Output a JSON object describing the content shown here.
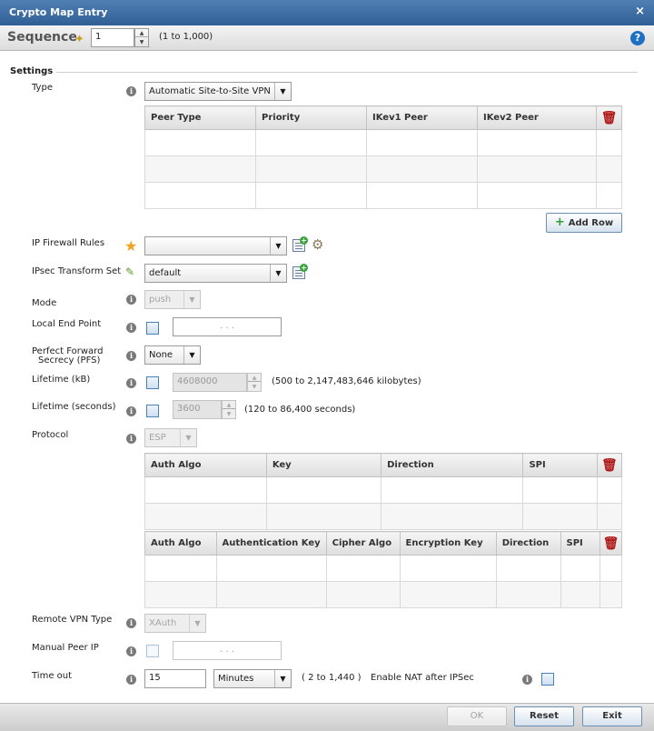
{
  "window": {
    "title": "Crypto Map Entry",
    "close_glyph": "×"
  },
  "sequence": {
    "label": "Sequence",
    "value": "1",
    "range": "(1 to 1,000)"
  },
  "section_title": "Settings",
  "type": {
    "label": "Type",
    "value": "Automatic Site-to-Site VPN"
  },
  "peer_table": {
    "headers": [
      "Peer Type",
      "Priority",
      "IKev1 Peer",
      "IKev2 Peer"
    ],
    "add_row_label": "Add Row"
  },
  "firewall": {
    "label": "IP Firewall Rules",
    "value": ""
  },
  "transform": {
    "label": "IPsec Transform Set",
    "value": "default"
  },
  "mode": {
    "label": "Mode",
    "value": "push"
  },
  "local_end_point": {
    "label": "Local End Point",
    "ip": ".        .        ."
  },
  "pfs": {
    "label_line1": "Perfect Forward",
    "label_line2": "Secrecy (PFS)",
    "value": "None"
  },
  "lifetime_kb": {
    "label": "Lifetime (kB)",
    "value": "4608000",
    "range": "(500 to 2,147,483,646 kilobytes)"
  },
  "lifetime_sec": {
    "label": "Lifetime (seconds)",
    "value": "3600",
    "range": "(120 to 86,400 seconds)"
  },
  "protocol": {
    "label": "Protocol",
    "value": "ESP"
  },
  "auth_table": {
    "headers": [
      "Auth Algo",
      "Key",
      "Direction",
      "SPI"
    ]
  },
  "enc_table": {
    "headers": [
      "Auth Algo",
      "Authentication Key",
      "Cipher Algo",
      "Encryption Key",
      "Direction",
      "SPI"
    ]
  },
  "remote_vpn": {
    "label": "Remote VPN Type",
    "value": "XAuth"
  },
  "manual_peer": {
    "label": "Manual Peer IP",
    "ip": ".        .        ."
  },
  "timeout": {
    "label": "Time out",
    "value": "15",
    "unit": "Minutes",
    "range": "( 2 to 1,440 )"
  },
  "nat": {
    "label": "Enable NAT after IPSec"
  },
  "footer": {
    "ok": "OK",
    "reset": "Reset",
    "exit": "Exit"
  },
  "icons": {
    "info": "info-icon",
    "help": "help-icon",
    "trash": "trash-icon",
    "star": "required-star-icon",
    "pencil": "pencil-icon",
    "wand": "wand-icon",
    "gear": "gear-icon",
    "add": "add-item-icon"
  },
  "colors": {
    "titlebar": "#3a6ea5",
    "accent": "#1f6fc2",
    "trash": "#b01818",
    "star": "#f4a020"
  }
}
